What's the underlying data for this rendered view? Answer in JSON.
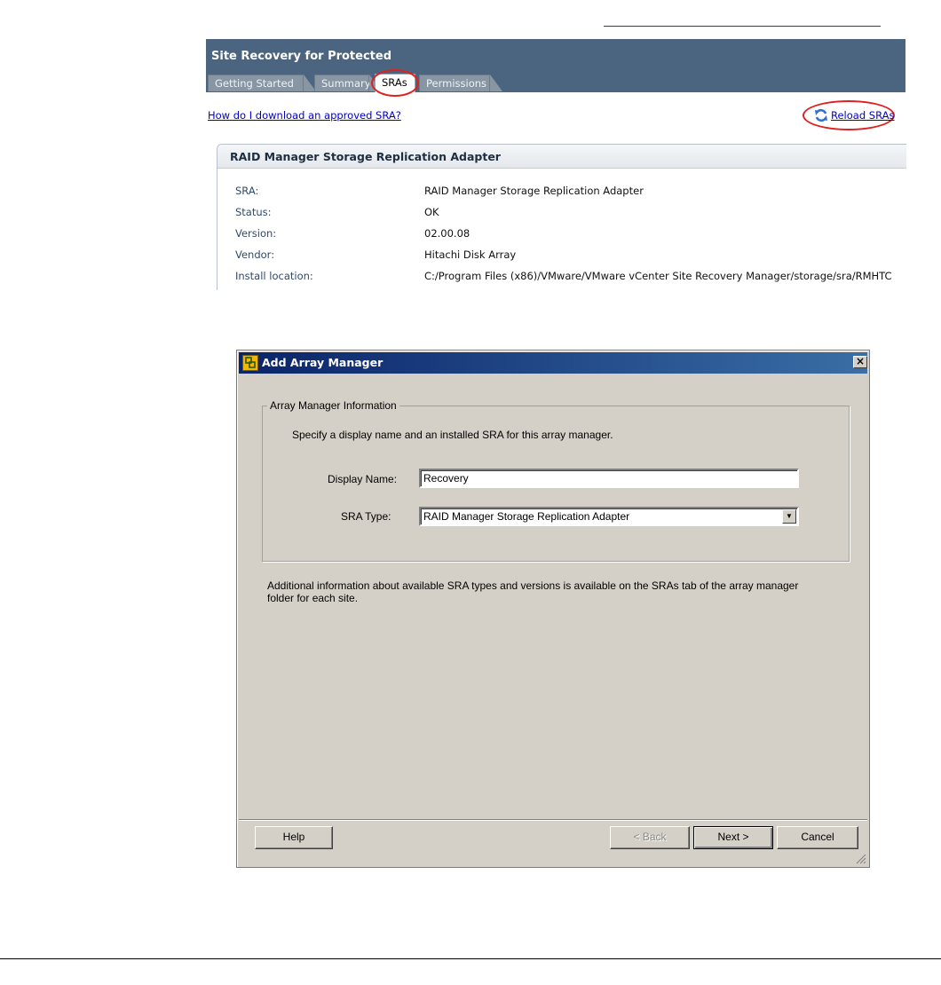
{
  "srm_panel": {
    "title": "Site Recovery for Protected",
    "tabs": [
      "Getting Started",
      "Summary",
      "SRAs",
      "Permissions"
    ],
    "active_tab": "SRAs",
    "help_link": "How do I download an approved SRA?",
    "reload_link": "Reload SRAs",
    "sra_card": {
      "title": "RAID Manager Storage Replication Adapter",
      "properties": [
        {
          "label": "SRA:",
          "value": "RAID Manager Storage Replication Adapter"
        },
        {
          "label": "Status:",
          "value": "OK"
        },
        {
          "label": "Version:",
          "value": "02.00.08"
        },
        {
          "label": "Vendor:",
          "value": "Hitachi Disk Array"
        },
        {
          "label": "Install location:",
          "value": "C:/Program Files (x86)/VMware/VMware vCenter Site Recovery Manager/storage/sra/RMHTC"
        }
      ]
    }
  },
  "dialog": {
    "title": "Add Array Manager",
    "group_title": "Array Manager Information",
    "instruction": "Specify a display name and an installed SRA for this array manager.",
    "display_name_label": "Display Name:",
    "display_name_value": "Recovery",
    "sra_type_label": "SRA Type:",
    "sra_type_value": "RAID Manager Storage Replication Adapter",
    "info_text_line1": "Additional information about available SRA types and versions is available on the SRAs tab of the array manager",
    "info_text_line2": "folder for each site.",
    "buttons": {
      "help": "Help",
      "back": "< Back",
      "next": "Next >",
      "cancel": "Cancel"
    }
  },
  "colors": {
    "header_bg": "#4b6580",
    "annotation_red": "#e02020",
    "link_blue": "#0000cc",
    "dialog_titlebar": "#0a246a"
  }
}
